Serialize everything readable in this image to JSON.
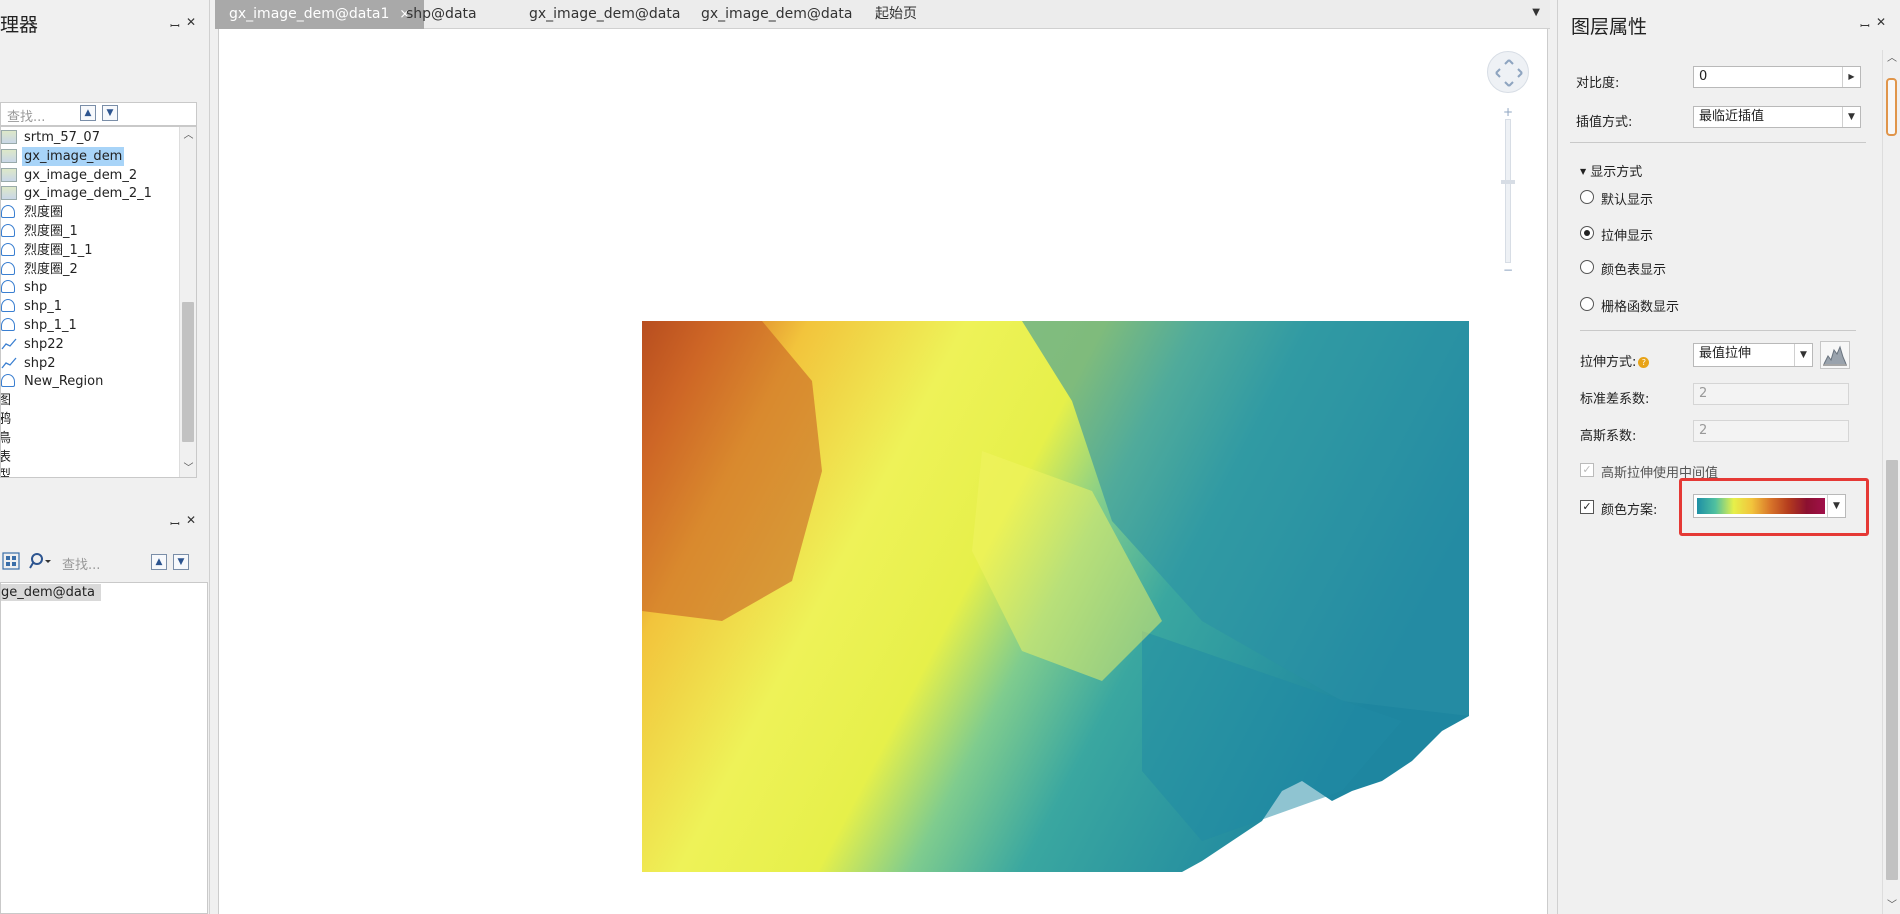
{
  "left_panel": {
    "title": "理器",
    "search_placeholder": "查找...",
    "layers": [
      {
        "name": "srtm_57_07",
        "type": "raster"
      },
      {
        "name": "gx_image_dem",
        "type": "raster",
        "selected": true
      },
      {
        "name": "gx_image_dem_2",
        "type": "raster"
      },
      {
        "name": "gx_image_dem_2_1",
        "type": "raster"
      },
      {
        "name": "烈度圈",
        "type": "region"
      },
      {
        "name": "烈度圈_1",
        "type": "region"
      },
      {
        "name": "烈度圈_1_1",
        "type": "region"
      },
      {
        "name": "烈度圈_2",
        "type": "region"
      },
      {
        "name": "shp",
        "type": "region"
      },
      {
        "name": "shp_1",
        "type": "region"
      },
      {
        "name": "shp_1_1",
        "type": "region"
      },
      {
        "name": "shp22",
        "type": "line"
      },
      {
        "name": "shp2",
        "type": "line"
      },
      {
        "name": "New_Region",
        "type": "region"
      }
    ],
    "group_labels": [
      "图",
      "鸦",
      "鳥",
      "表",
      "型"
    ],
    "lower_search_placeholder": "查找...",
    "lower_tree_item": "ge_dem@data"
  },
  "tabs": [
    {
      "label": "gx_image_dem@data1",
      "active": true,
      "close": "×"
    },
    {
      "label": "shp@data"
    },
    {
      "label": "gx_image_dem@data"
    },
    {
      "label": "gx_image_dem@data"
    },
    {
      "label": "起始页"
    }
  ],
  "right_panel": {
    "title": "图层属性",
    "contrast_label": "对比度:",
    "contrast_value": "0",
    "interp_label": "插值方式:",
    "interp_value": "最临近插值",
    "display_section": "显示方式",
    "display_options": [
      {
        "label": "默认显示",
        "selected": false
      },
      {
        "label": "拉伸显示",
        "selected": true
      },
      {
        "label": "颜色表显示",
        "selected": false
      },
      {
        "label": "栅格函数显示",
        "selected": false
      }
    ],
    "stretch_label": "拉伸方式:",
    "stretch_value": "最值拉伸",
    "stddev_label": "标准差系数:",
    "stddev_value": "2",
    "gauss_label": "高斯系数:",
    "gauss_value": "2",
    "gauss_mid_label": "高斯拉伸使用中间值",
    "color_scheme_label": "颜色方案:",
    "color_scheme_gradient": [
      "#1e8fa5",
      "#4fc0a0",
      "#e6f04a",
      "#f2c43c",
      "#d9762a",
      "#b43c1e",
      "#8c1030",
      "#a0104a"
    ]
  },
  "colors": {
    "highlight": "#e53935",
    "active_tab": "#a9a9a9",
    "selection": "#a8d4f8"
  }
}
